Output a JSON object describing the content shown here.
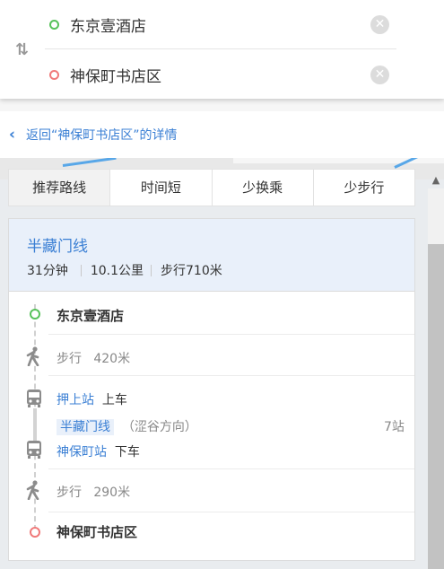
{
  "search": {
    "start_value": "东京壹酒店",
    "end_value": "神保町书店区"
  },
  "back_link": {
    "label": "返回“神保町书店区”的详情"
  },
  "tabs": [
    "推荐路线",
    "时间短",
    "少换乘",
    "少步行"
  ],
  "route": {
    "line_name": "半藏门线",
    "duration": "31分钟",
    "distance": "10.1公里",
    "walk_total": "步行710米",
    "steps": {
      "start": "东京壹酒店",
      "walk1": "步行",
      "walk1_dist": "420米",
      "board_station": "押上站",
      "board_action": "上车",
      "line_badge": "半藏门线",
      "direction": "（涩谷方向）",
      "stops": "7站",
      "alight_station": "神保町站",
      "alight_action": "下车",
      "walk2": "步行",
      "walk2_dist": "290米",
      "end": "神保町书店区"
    }
  },
  "colors": {
    "accent": "#3a7fd4",
    "start_dot": "#58c25b",
    "end_dot": "#f07a7a",
    "header_bg": "#e9f0fa"
  },
  "icons": [
    "swap-icon",
    "clear-icon",
    "chevron-left-icon",
    "walk-icon",
    "bus-icon",
    "scroll-up-icon"
  ]
}
